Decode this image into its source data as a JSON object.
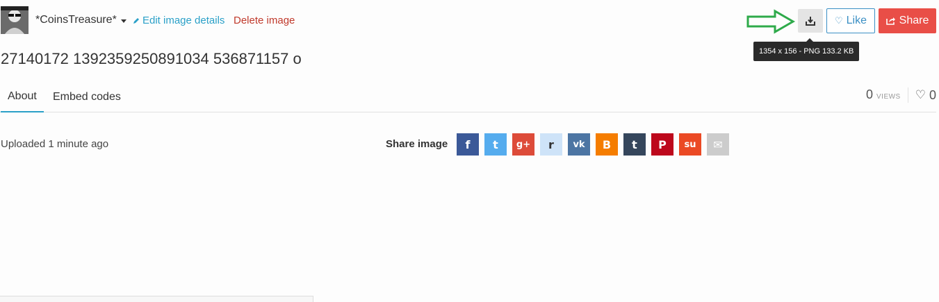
{
  "header": {
    "username": "*CoinsTreasure*",
    "edit_label": "Edit image details",
    "delete_label": "Delete image",
    "like_label": "Like",
    "share_label": "Share",
    "tooltip": "1354 x 156 - PNG 133.2 KB"
  },
  "title": "27140172 1392359250891034 536871157 o",
  "tabs": [
    {
      "label": "About",
      "active": true
    },
    {
      "label": "Embed codes",
      "active": false
    }
  ],
  "stats": {
    "views_count": "0",
    "views_label": "VIEWS",
    "likes_count": "0"
  },
  "content": {
    "uploaded": "Uploaded 1 minute ago",
    "share_label": "Share image"
  },
  "share_icons": [
    {
      "name": "facebook-icon",
      "glyph": "f",
      "color": "#3b5998"
    },
    {
      "name": "twitter-icon",
      "glyph": "t",
      "color": "#55acee"
    },
    {
      "name": "google-plus-icon",
      "glyph": "g+",
      "color": "#dd4b39"
    },
    {
      "name": "reddit-icon",
      "glyph": "r",
      "color": "#cee3f8"
    },
    {
      "name": "vk-icon",
      "glyph": "vk",
      "color": "#4c75a3"
    },
    {
      "name": "blogger-icon",
      "glyph": "B",
      "color": "#f57d00"
    },
    {
      "name": "tumblr-icon",
      "glyph": "t",
      "color": "#35465c"
    },
    {
      "name": "pinterest-icon",
      "glyph": "P",
      "color": "#bd081c"
    },
    {
      "name": "stumbleupon-icon",
      "glyph": "su",
      "color": "#eb4924"
    },
    {
      "name": "email-icon",
      "glyph": "✉",
      "color": "#cccccc"
    }
  ],
  "colors": {
    "accent": "#2aa0c8",
    "delete": "#c0392b",
    "share_button": "#e94e47",
    "arrow": "#2eaa4a"
  }
}
